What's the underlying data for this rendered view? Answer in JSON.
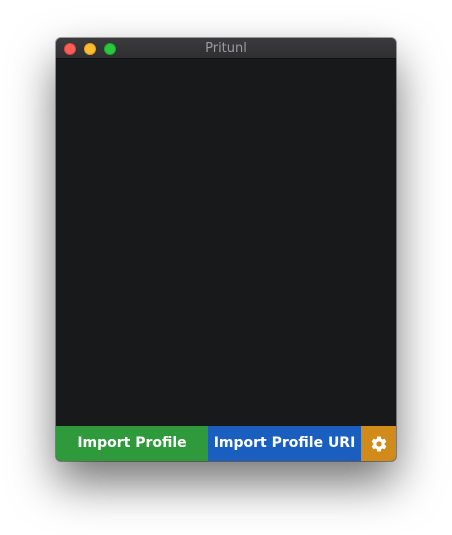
{
  "window": {
    "title": "Pritunl"
  },
  "bottom_bar": {
    "import_profile_label": "Import Profile",
    "import_profile_uri_label": "Import Profile URI",
    "settings_icon": "gear-icon"
  },
  "colors": {
    "background": "#18191b",
    "import_profile": "#2e9a3b",
    "import_profile_uri": "#1a5fbf",
    "settings": "#d08b1a"
  }
}
